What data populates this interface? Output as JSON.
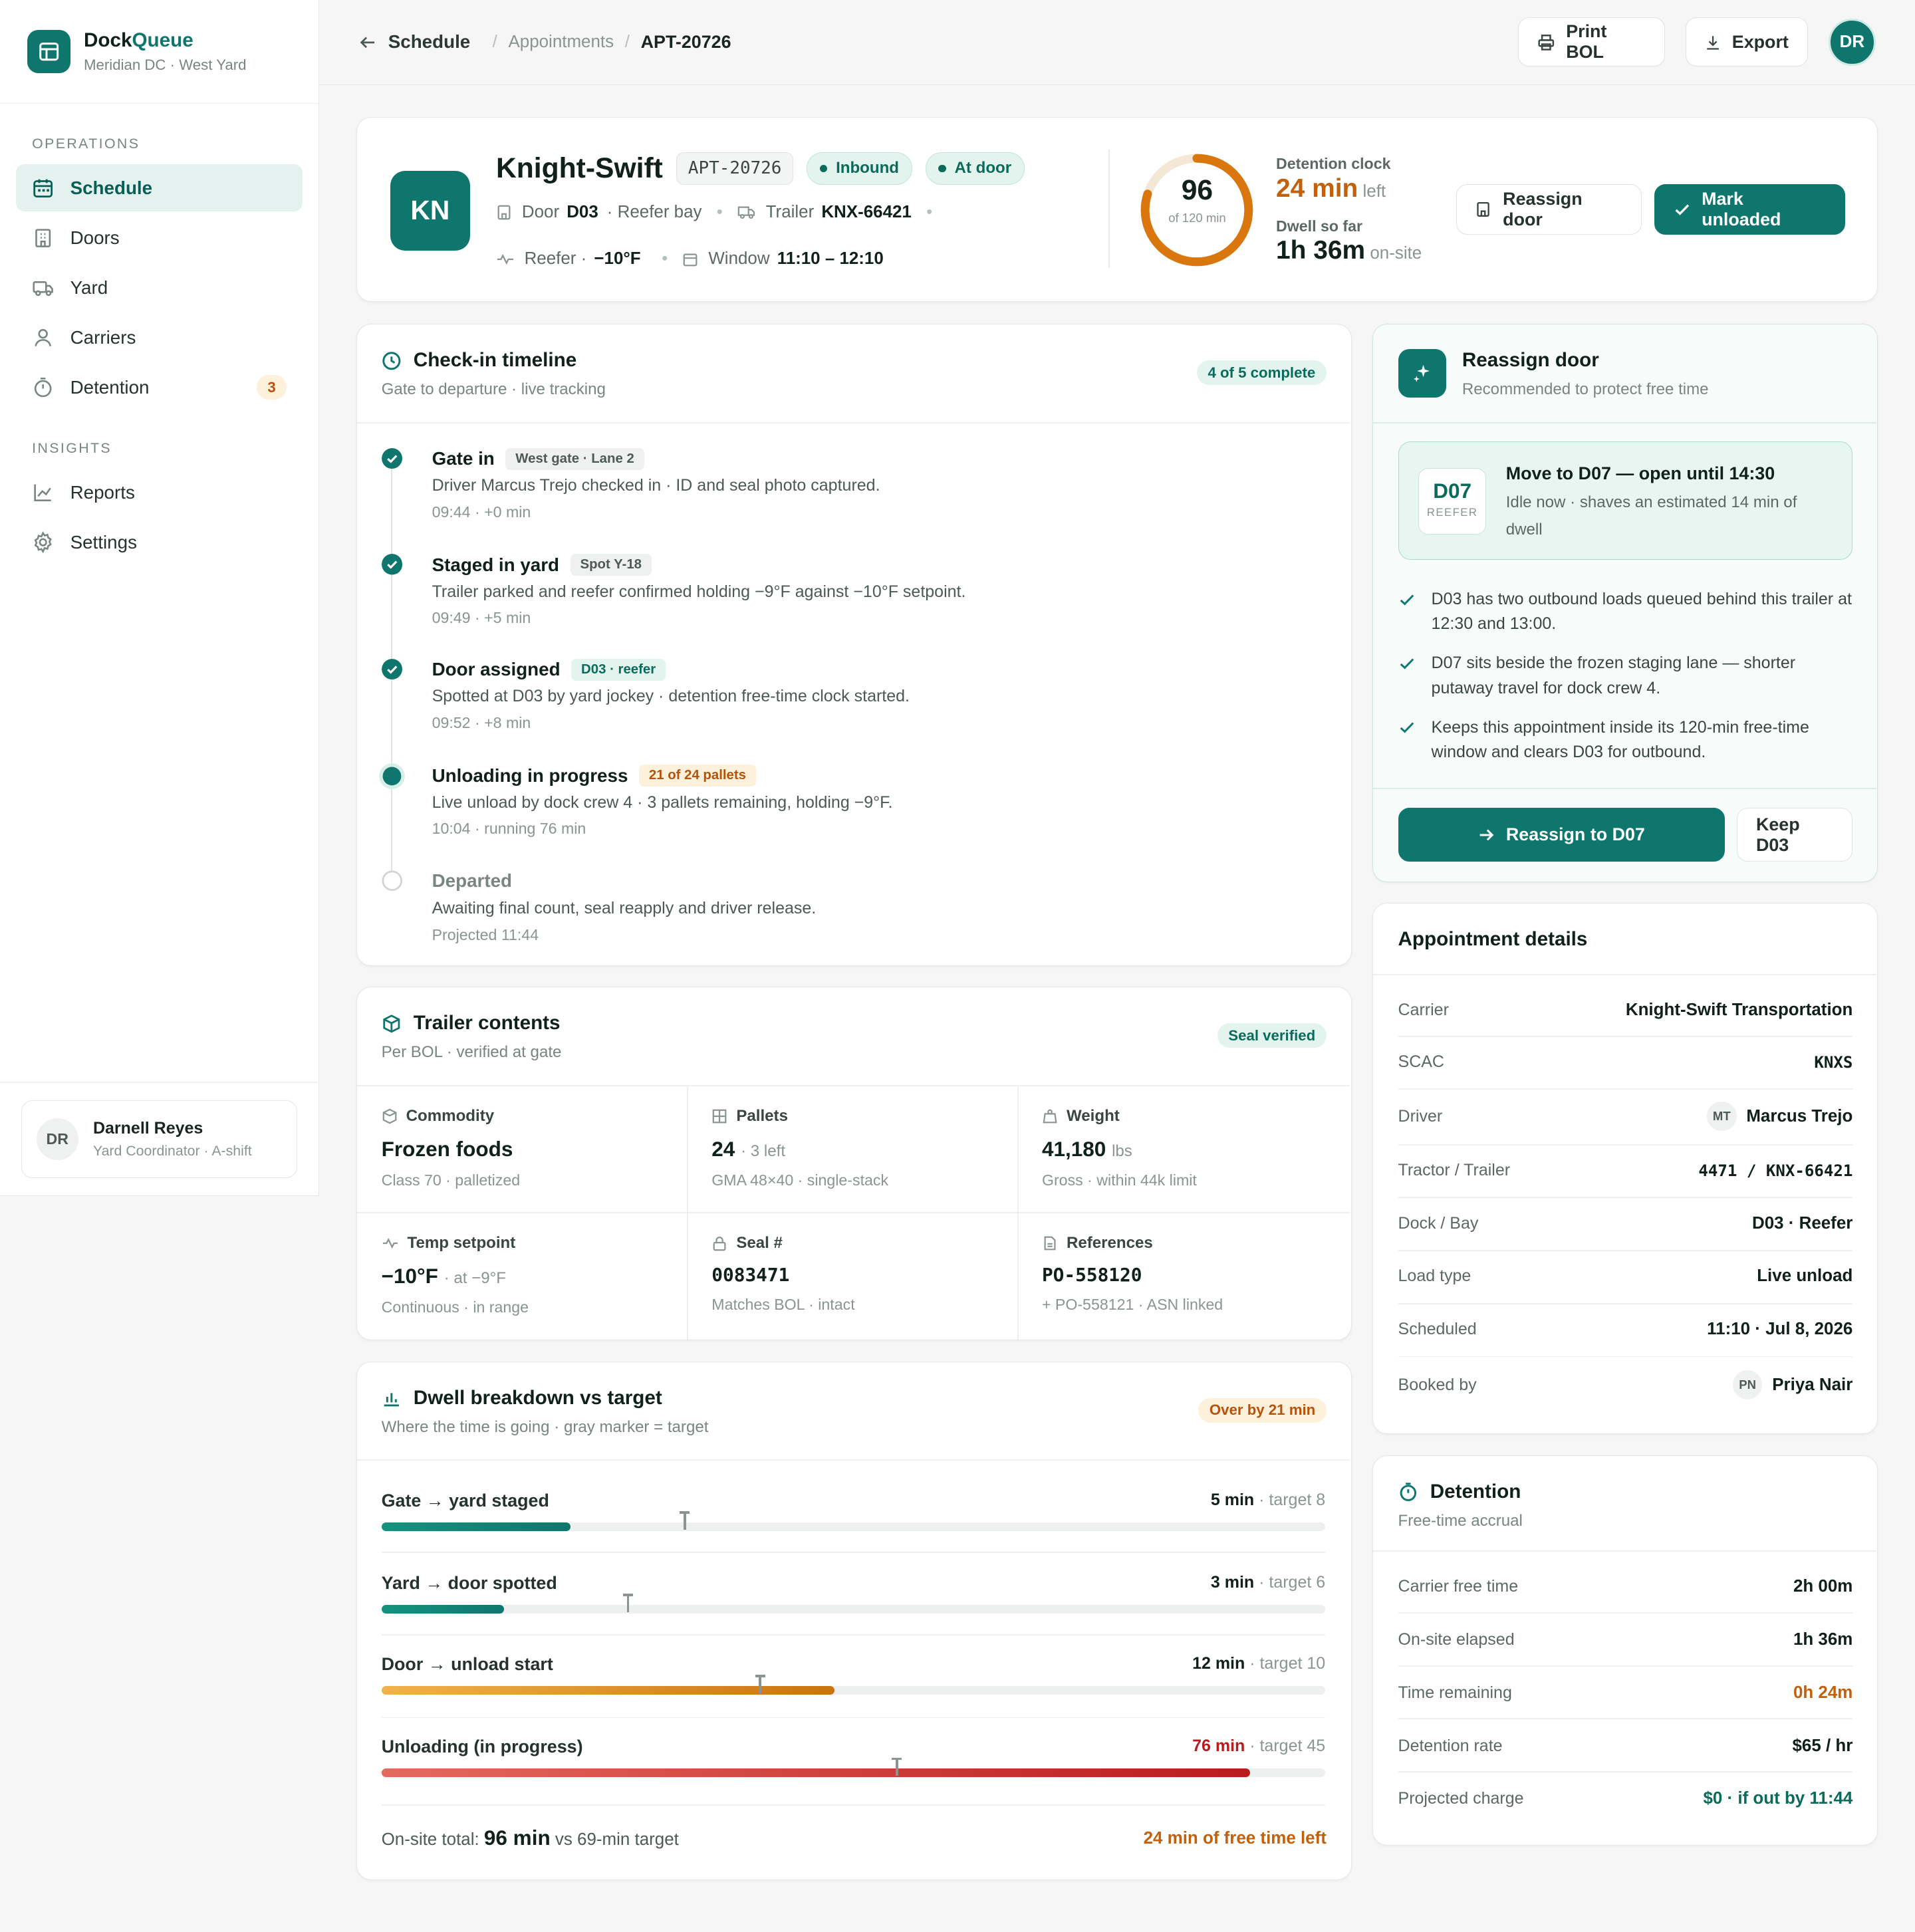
{
  "app": {
    "name_a": "Dock",
    "name_b": "Queue",
    "subtitle": "Meridian DC · West Yard"
  },
  "nav": {
    "section_operations": "OPERATIONS",
    "section_insights": "INSIGHTS",
    "schedule": "Schedule",
    "doors": "Doors",
    "yard": "Yard",
    "carriers": "Carriers",
    "detention": "Detention",
    "detention_badge": "3",
    "reports": "Reports",
    "settings": "Settings"
  },
  "user": {
    "initials": "DR",
    "name": "Darnell Reyes",
    "role": "Yard Coordinator · A-shift"
  },
  "breadcrumb": {
    "back": "Schedule",
    "sep": "/",
    "appointments": "Appointments",
    "current": "APT-20726"
  },
  "toolbar": {
    "print": "Print BOL",
    "export": "Export",
    "avatar": "DR"
  },
  "hero": {
    "initials": "KN",
    "carrier": "Knight-Swift",
    "apt": "APT-20726",
    "status_inbound": "Inbound",
    "status_door": "At door",
    "door_label": "Door",
    "door": "D03",
    "bay": "· Reefer bay",
    "trailer_label": "Trailer",
    "trailer": "KNX-66421",
    "dot": "•",
    "reefer_label": "Reefer ·",
    "reefer_temp": "−10°F",
    "window_label": "Window",
    "window": "11:10 – 12:10",
    "ring_value": "96",
    "ring_sub": "of 120 min",
    "ring_fraction": 0.8,
    "detention_label": "Detention clock",
    "detention_value": "24 min",
    "detention_suffix": "left",
    "dwell_label": "Dwell so far",
    "dwell_value": "1h 36m",
    "dwell_suffix": "on-site",
    "reassign_btn": "Reassign door",
    "unloaded_btn": "Mark unloaded"
  },
  "timeline": {
    "title": "Check-in timeline",
    "subtitle": "Gate to departure · live tracking",
    "badge": "4 of 5 complete",
    "items": [
      {
        "title": "Gate in",
        "tag": "West gate · Lane 2",
        "desc": "Driver Marcus Trejo checked in · ID and seal photo captured.",
        "time": "09:44 · +0 min"
      },
      {
        "title": "Staged in yard",
        "tag": "Spot Y-18",
        "desc": "Trailer parked and reefer confirmed holding −9°F against −10°F setpoint.",
        "time": "09:49 · +5 min"
      },
      {
        "title": "Door assigned",
        "tag": "D03 · reefer",
        "desc": "Spotted at D03 by yard jockey · detention free-time clock started.",
        "time": "09:52 · +8 min"
      },
      {
        "title": "Unloading in progress",
        "tag": "21 of 24 pallets",
        "desc": "Live unload by dock crew 4 · 3 pallets remaining, holding −9°F.",
        "time": "10:04 · running 76 min"
      },
      {
        "title": "Departed",
        "tag": "",
        "desc": "Awaiting final count, seal reapply and driver release.",
        "time": "Projected 11:44"
      }
    ]
  },
  "contents": {
    "title": "Trailer contents",
    "subtitle": "Per BOL · verified at gate",
    "badge": "Seal verified",
    "commodity": {
      "label": "Commodity",
      "value": "Frozen foods",
      "note": "Class 70 · palletized"
    },
    "pallets": {
      "label": "Pallets",
      "value": "24",
      "unit": "· 3 left",
      "note": "GMA 48×40 · single-stack"
    },
    "weight": {
      "label": "Weight",
      "value": "41,180",
      "unit": "lbs",
      "note": "Gross · within 44k limit"
    },
    "temp": {
      "label": "Temp setpoint",
      "value": "−10°F",
      "unit": "· at −9°F",
      "note": "Continuous · in range"
    },
    "seal": {
      "label": "Seal #",
      "value": "0083471",
      "note": "Matches BOL · intact"
    },
    "refs": {
      "label": "References",
      "value": "PO-558120",
      "note": "+ PO-558121 · ASN linked"
    }
  },
  "dwell": {
    "title": "Dwell breakdown vs target",
    "subtitle": "Where the time is going · gray marker = target",
    "badge": "Over by 21 min",
    "scale_max": 100,
    "rows": [
      {
        "label": "Gate → yard staged",
        "value": "5 min",
        "target_text": "· target 8",
        "minutes": 5,
        "target": 8
      },
      {
        "label": "Yard → door spotted",
        "value": "3 min",
        "target_text": "· target 6",
        "minutes": 3,
        "target": 6
      },
      {
        "label": "Door → unload start",
        "value": "12 min",
        "target_text": "· target 10",
        "minutes": 12,
        "target": 10
      },
      {
        "label": "Unloading (in progress)",
        "value": "76 min",
        "target_text": "· target 45",
        "minutes": 76,
        "target": 45
      }
    ],
    "total_label": "On-site total:",
    "total_value": "96 min",
    "total_suffix": "vs 69-min target",
    "free_left": "24 min of free time left"
  },
  "reassign": {
    "title": "Reassign door",
    "subtitle": "Recommended to protect free time",
    "door": "D07",
    "door_type": "REEFER",
    "headline": "Move to D07 — open until 14:30",
    "detail": "Idle now · shaves an estimated 14 min of dwell",
    "reasons": [
      "D03 has two outbound loads queued behind this trailer at 12:30 and 13:00.",
      "D07 sits beside the frozen staging lane — shorter putaway travel for dock crew 4.",
      "Keeps this appointment inside its 120-min free-time window and clears D03 for outbound."
    ],
    "primary": "Reassign to D07",
    "secondary": "Keep D03"
  },
  "details": {
    "title": "Appointment details",
    "carrier_k": "Carrier",
    "carrier_v": "Knight-Swift Transportation",
    "scac_k": "SCAC",
    "scac_v": "KNXS",
    "driver_k": "Driver",
    "driver_initials": "MT",
    "driver_v": "Marcus Trejo",
    "tractor_k": "Tractor / Trailer",
    "tractor_v": "4471 / KNX-66421",
    "dock_k": "Dock / Bay",
    "dock_v": "D03 · Reefer",
    "load_k": "Load type",
    "load_v": "Live unload",
    "sched_k": "Scheduled",
    "sched_v": "11:10 · Jul 8, 2026",
    "booked_k": "Booked by",
    "booked_initials": "PN",
    "booked_v": "Priya Nair"
  },
  "detention": {
    "title": "Detention",
    "subtitle": "Free-time accrual",
    "free_k": "Carrier free time",
    "free_v": "2h 00m",
    "elapsed_k": "On-site elapsed",
    "elapsed_v": "1h 36m",
    "remain_k": "Time remaining",
    "remain_v": "0h 24m",
    "rate_k": "Detention rate",
    "rate_v": "$65 / hr",
    "proj_k": "Projected charge",
    "proj_v": "$0 · if out by 11:44"
  },
  "colors": {
    "accent": "#0f766e",
    "amber": "#c2610c",
    "red": "#b91c1c"
  }
}
